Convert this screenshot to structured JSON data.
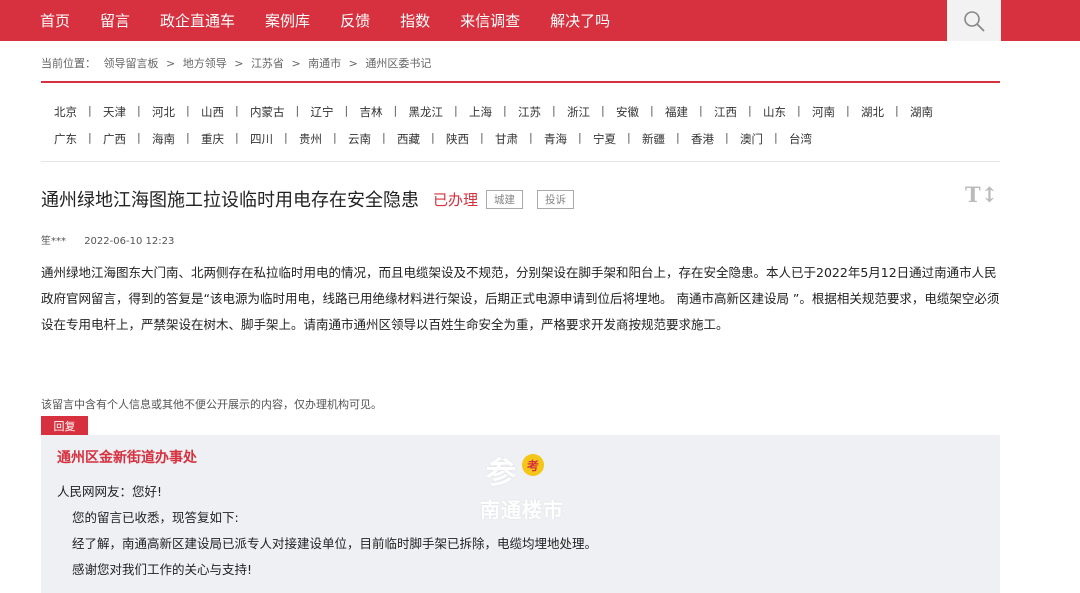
{
  "nav": {
    "items": [
      "首页",
      "留言",
      "政企直通车",
      "案例库",
      "反馈",
      "指数",
      "来信调查",
      "解决了吗"
    ],
    "search_icon": "search-icon"
  },
  "breadcrumb": {
    "prefix": "当前位置：",
    "items": [
      "领导留言板",
      "地方领导",
      "江苏省",
      "南通市",
      "通州区委书记"
    ],
    "separator": ">"
  },
  "regions": {
    "row1": [
      "北京",
      "天津",
      "河北",
      "山西",
      "内蒙古",
      "辽宁",
      "吉林",
      "黑龙江",
      "上海",
      "江苏",
      "浙江",
      "安徽",
      "福建",
      "江西",
      "山东",
      "河南",
      "湖北",
      "湖南"
    ],
    "row2": [
      "广东",
      "广西",
      "海南",
      "重庆",
      "四川",
      "贵州",
      "云南",
      "西藏",
      "陕西",
      "甘肃",
      "青海",
      "宁夏",
      "新疆",
      "香港",
      "澳门",
      "台湾"
    ]
  },
  "message": {
    "title": "通州绿地江海图施工拉设临时用电存在安全隐患",
    "status": "已办理",
    "tags": [
      "城建",
      "投诉"
    ],
    "font_toggle": "T↕",
    "author": "笙***",
    "date": "2022-06-10 12:23",
    "content": "通州绿地江海图东大门南、北两侧存在私拉临时用电的情况，而且电缆架设及不规范，分别架设在脚手架和阳台上，存在安全隐患。本人已于2022年5月12日通过南通市人民政府官网留言，得到的答复是“该电源为临时用电，线路已用绝缘材料进行架设，后期正式电源申请到位后将埋地。 南通市高新区建设局 ”。根据相关规范要求，电缆架空必须设在专用电杆上，严禁架设在树木、脚手架上。请南通市通州区领导以百姓生命安全为重，严格要求开发商按规范要求施工。",
    "privacy_note": "该留言中含有个人信息或其他不便公开展示的内容，仅办理机构可见。"
  },
  "reply": {
    "tab_label": "回复",
    "org": "通州区金新街道办事处",
    "greeting": "人民网网友：您好!",
    "lines": [
      "您的留言已收悉，现答复如下:",
      "经了解，南通高新区建设局已派专人对接建设单位，目前临时脚手架已拆除，电缆均埋地处理。",
      "感谢您对我们工作的关心与支持!"
    ]
  },
  "watermark": {
    "char": "参",
    "badge": "考",
    "text": "南通楼市"
  },
  "colors": {
    "brand_red": "#d7303e",
    "reply_bg": "#eef0f4"
  }
}
